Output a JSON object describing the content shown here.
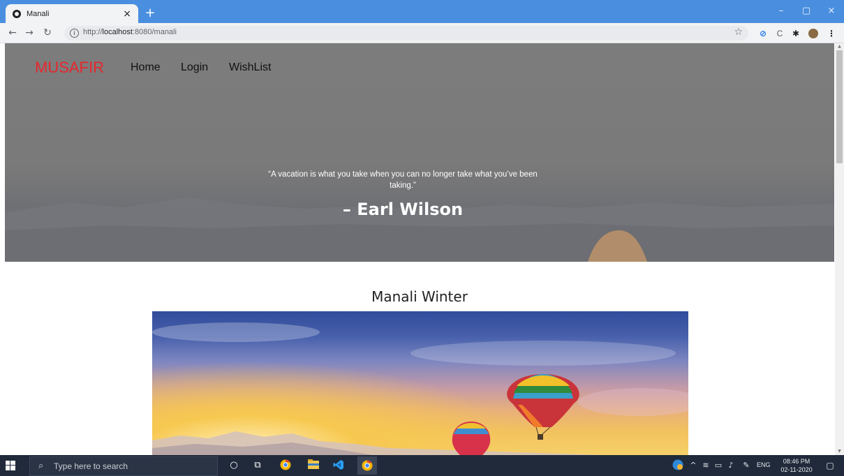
{
  "browser": {
    "tab_title": "Manali",
    "tab_close": "×",
    "new_tab": "+",
    "url_prefix": "http://",
    "url_host": "localhost",
    "url_rest": ":8080/manali",
    "window_controls": [
      "–",
      "▢",
      "×"
    ],
    "extension_icons": [
      "star-icon",
      "color-picker-icon",
      "extension-c-icon",
      "puzzle-icon",
      "profile-avatar-icon",
      "menu-icon"
    ]
  },
  "site": {
    "brand": "MUSAFIR",
    "nav": [
      "Home",
      "Login",
      "WishList"
    ],
    "quote": "“A vacation is what you take when you can no longer take what you’ve been taking.”",
    "quote_author": "– Earl Wilson",
    "section_title": "Manali Winter"
  },
  "taskbar": {
    "search_placeholder": "Type here to search",
    "language": "ENG",
    "time": "08:46 PM",
    "date": "02-11-2020"
  },
  "colors": {
    "brand": "#e8262c",
    "tab_strip": "#4a8fdf",
    "taskbar": "#202a3a"
  }
}
